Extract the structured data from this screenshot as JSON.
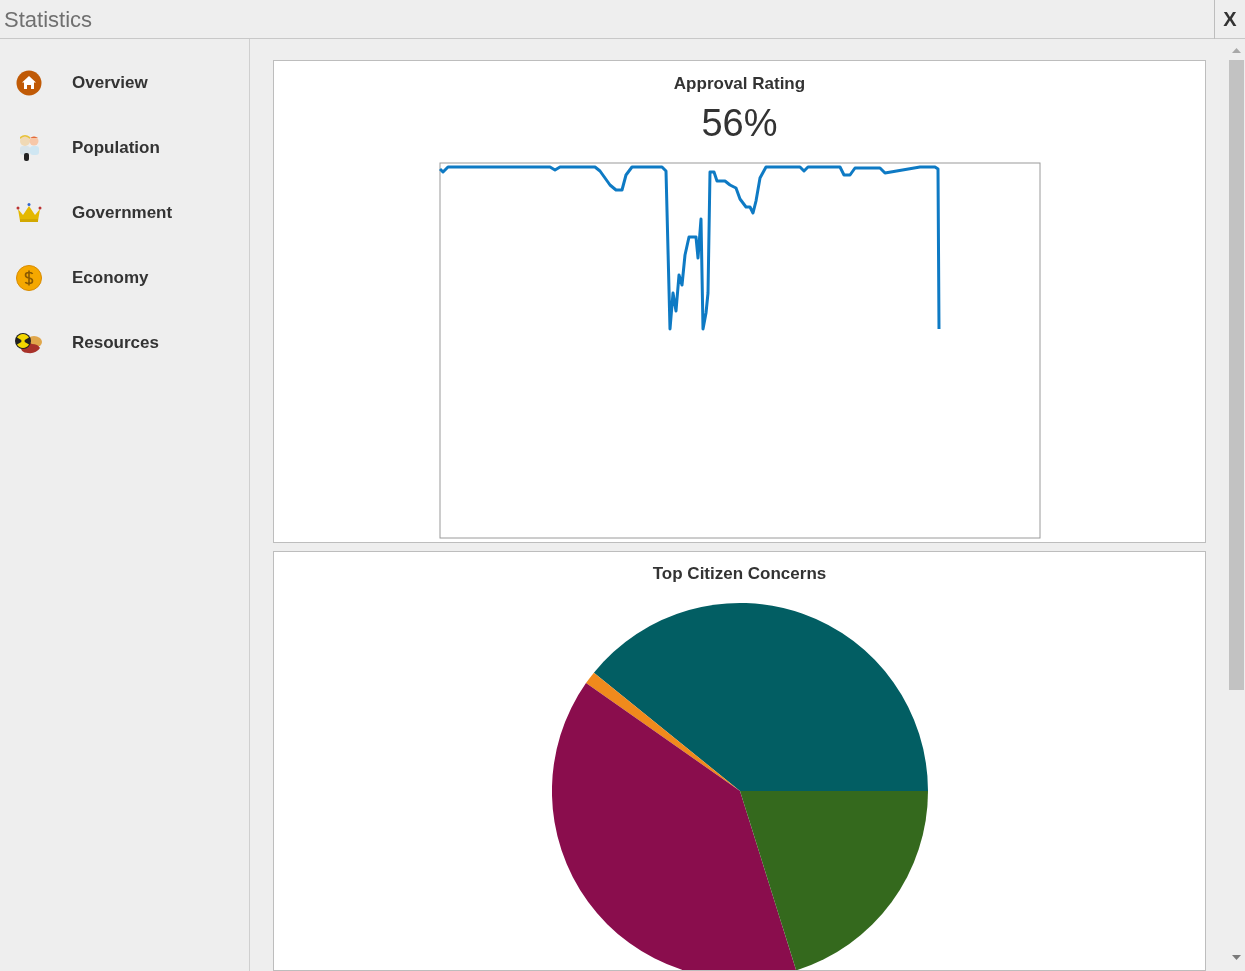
{
  "window": {
    "title": "Statistics",
    "close": "X"
  },
  "sidebar": {
    "items": [
      {
        "label": "Overview",
        "kind": "home"
      },
      {
        "label": "Population",
        "kind": "people"
      },
      {
        "label": "Government",
        "kind": "crown"
      },
      {
        "label": "Economy",
        "kind": "coin"
      },
      {
        "label": "Resources",
        "kind": "resources"
      }
    ]
  },
  "approval": {
    "title": "Approval Rating",
    "value": "56%"
  },
  "concerns": {
    "title": "Top Citizen Concerns"
  }
}
